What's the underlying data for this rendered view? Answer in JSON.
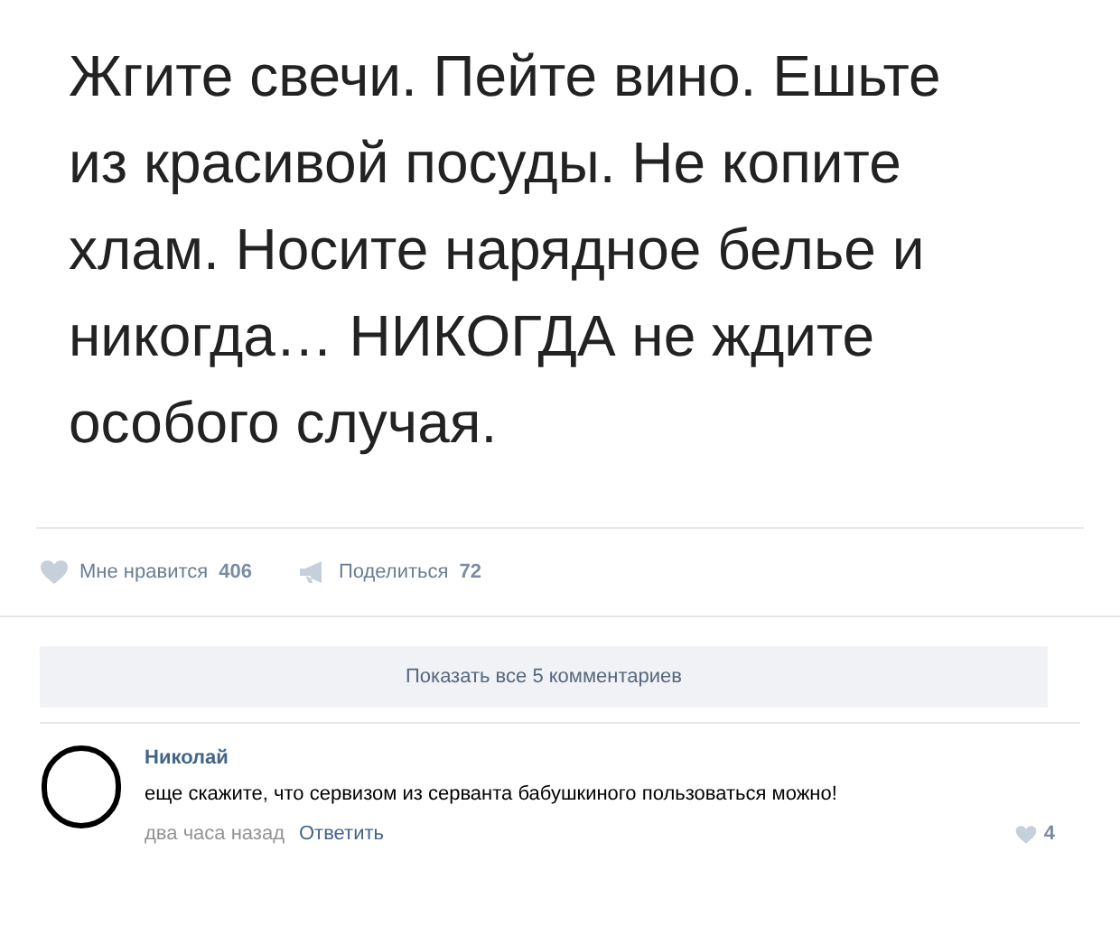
{
  "post": {
    "text": "Жгите свечи. Пейте вино. Ешьте из красивой посуды. Не копите хлам. Носите нарядное белье и никогда… НИКОГДА не ждите особого случая."
  },
  "actions": [
    {
      "kind": "like",
      "label": "Мне нравится",
      "count": "406"
    },
    {
      "kind": "share",
      "label": "Поделиться",
      "count": "72"
    }
  ],
  "show_comments_button": "Показать все 5 комментариев",
  "comments": [
    {
      "author": "Николай",
      "text": "еще скажите, что сервизом из серванта бабушкиного пользоваться можно!",
      "time": "два часа назад",
      "reply": "Ответить",
      "likes": "4"
    }
  ]
}
